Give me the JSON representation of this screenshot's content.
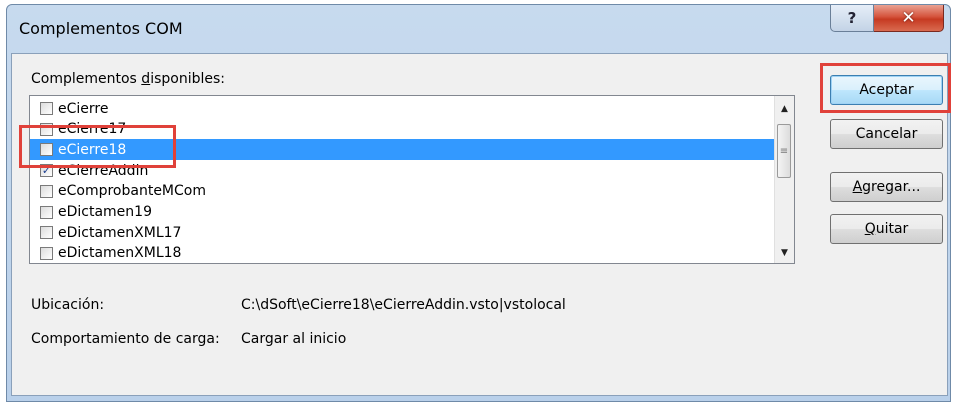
{
  "window": {
    "title": "Complementos COM",
    "help_label": "?",
    "close_label": "✕"
  },
  "list": {
    "label_prefix": "Complementos ",
    "label_underlined": "d",
    "label_suffix": "isponibles:",
    "items": [
      {
        "name": "eCierre",
        "checked": false,
        "selected": false
      },
      {
        "name": "eCierre17",
        "checked": false,
        "selected": false
      },
      {
        "name": "eCierre18",
        "checked": false,
        "selected": true
      },
      {
        "name": "eCierreAddin",
        "checked": true,
        "selected": false
      },
      {
        "name": "eComprobanteMCom",
        "checked": false,
        "selected": false
      },
      {
        "name": "eDictamen19",
        "checked": false,
        "selected": false
      },
      {
        "name": "eDictamenXML17",
        "checked": false,
        "selected": false
      },
      {
        "name": "eDictamenXML18",
        "checked": false,
        "selected": false
      }
    ]
  },
  "buttons": {
    "accept": "Aceptar",
    "cancel": "Cancelar",
    "add_underlined": "A",
    "add_rest": "gregar...",
    "remove_underlined": "Q",
    "remove_rest": "uitar"
  },
  "details": {
    "location_label": "Ubicación:",
    "location_value": "C:\\dSoft\\eCierre18\\eCierreAddin.vsto|vstolocal",
    "load_label": "Comportamiento de carga:",
    "load_value": "Cargar al inicio"
  },
  "icons": {
    "scroll_up": "scroll-up-arrow-icon",
    "scroll_down": "scroll-down-arrow-icon",
    "thumb_grip": "scroll-grip-icon"
  },
  "colors": {
    "selection": "#3399ff",
    "highlight_box": "#e0413a",
    "close_button": "#c63a22"
  }
}
